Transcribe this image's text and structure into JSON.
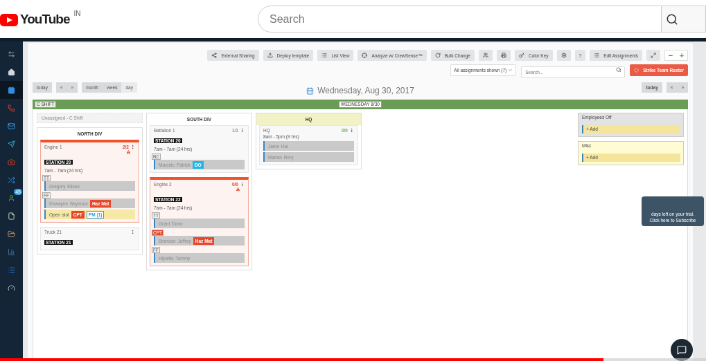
{
  "header": {
    "logo": "YouTube",
    "region": "IN",
    "search": {
      "placeholder": "Search"
    }
  },
  "sidebar": {
    "items": [
      {
        "kind": "swap",
        "selected": false
      },
      {
        "kind": "home",
        "selected": false
      },
      {
        "kind": "calendar",
        "selected": true
      },
      {
        "kind": "phone",
        "selected": false
      },
      {
        "kind": "mail",
        "selected": false
      },
      {
        "kind": "send",
        "selected": false
      },
      {
        "kind": "camera",
        "selected": false
      },
      {
        "kind": "shuffle",
        "selected": false
      },
      {
        "kind": "person",
        "selected": false,
        "badge": "45"
      },
      {
        "kind": "file",
        "selected": false
      },
      {
        "kind": "folder",
        "selected": false
      },
      {
        "kind": "signal",
        "selected": false
      },
      {
        "kind": "list",
        "selected": false
      },
      {
        "kind": "gauge",
        "selected": false
      }
    ]
  },
  "toolbar": [
    {
      "kind": "share",
      "label": "External Sharing"
    },
    {
      "kind": "upload",
      "label": "Deploy template"
    },
    {
      "kind": "list",
      "label": "List View"
    },
    {
      "kind": "target",
      "label": "Analyze w/ CrewSense™"
    },
    {
      "kind": "refresh",
      "label": "Bulk Change"
    },
    {
      "kind": "users"
    },
    {
      "kind": "print"
    },
    {
      "kind": "key",
      "label": "Color Key"
    },
    {
      "kind": "settings"
    },
    {
      "kind": "text",
      "label": "?"
    },
    {
      "kind": "list",
      "label": "Edit Assignments"
    },
    {
      "kind": "expand"
    }
  ],
  "zoom": {
    "minus": "−",
    "plus": "+"
  },
  "filter": "All assignments shown (7)",
  "search": {
    "placeholder": "Search..."
  },
  "strike_button": "Strike Team Roster",
  "nav_left": {
    "today": "today",
    "prev": "«",
    "next": "»",
    "views": [
      {
        "label": "month",
        "selected": false
      },
      {
        "label": "week",
        "selected": false
      },
      {
        "label": "day",
        "selected": true
      }
    ]
  },
  "date_title": "Wednesday, Aug 30, 2017",
  "nav_right": {
    "today": "today",
    "prev": "«",
    "next": "»"
  },
  "shift": {
    "name": "C SHIFT",
    "day": "WEDNESDAY 8/30"
  },
  "unassigned": "Unassigned - C Shift",
  "divisions": [
    {
      "name": "NORTH DIV",
      "color": "#ffffff",
      "units": [
        {
          "name": "Engine 1",
          "count": "2/2",
          "alert": true,
          "station": "STATION 20",
          "hours": "7am - 7am (24 hrs)",
          "members": [
            {
              "kind": "person",
              "name": "Gregory  Ellseo",
              "rank": {
                "label": "TT",
                "color": "#eeeeee"
              }
            },
            {
              "kind": "person",
              "name": "Dewayne  Seymour",
              "rank": {
                "label": "FF",
                "color": "#eeeeee"
              },
              "tags": [
                {
                  "label": "Haz Mat",
                  "color": "#e8472a",
                  "outline": false
                }
              ]
            },
            {
              "kind": "slot",
              "name": "Open slot",
              "tags": [
                {
                  "label": "CPT",
                  "color": "#e8472a",
                  "outline": false
                },
                {
                  "label": "PM (1)",
                  "color": "#3a9ad9",
                  "outline": true
                }
              ]
            }
          ]
        },
        {
          "name": "Truck 21",
          "alert": false,
          "station": "STATION 21"
        }
      ]
    },
    {
      "name": "SOUTH DIV",
      "color": "#ffffff",
      "units": [
        {
          "name": "Battalion 1",
          "count": "1/1",
          "alert": false,
          "station": "STATION 20",
          "hours": "7am - 7am (24 hrs)",
          "members": [
            {
              "kind": "person",
              "name": "Marcelo  Patrick",
              "rank": {
                "label": "BC",
                "color": "#eeeeee"
              },
              "tags": [
                {
                  "label": "DO",
                  "color": "#22b5e8",
                  "outline": false
                }
              ]
            }
          ]
        },
        {
          "name": "Engine 2",
          "count": "0/0",
          "alert": true,
          "station": "STATION 22",
          "hours": "7am - 7am (24 hrs)",
          "members": [
            {
              "kind": "person",
              "name": "Grant  Donn",
              "rank": {
                "label": "TT",
                "color": "#eeeeee"
              }
            },
            {
              "kind": "person",
              "name": "Brandon Jeffrey",
              "rank": {
                "label": "CPT",
                "color": "#e8472a"
              },
              "tags": [
                {
                  "label": "Haz Mat",
                  "color": "#e8472a",
                  "outline": false
                }
              ]
            },
            {
              "kind": "person",
              "name": "Hipolito  Tommy",
              "rank": {
                "label": "FF",
                "color": "#eeeeee"
              }
            }
          ]
        }
      ]
    },
    {
      "name": "HQ",
      "color": "#f3f2c6",
      "units": [
        {
          "name": "HQ",
          "count": "0/0",
          "alert": false,
          "hours": "8am - 5pm (9 hrs)",
          "members": [
            {
              "kind": "person",
              "name": "Jame  Hai"
            },
            {
              "kind": "person",
              "name": "Marlon  Rory"
            }
          ]
        }
      ]
    }
  ],
  "side_lists": [
    {
      "title": "Employees Off",
      "color": "#e3e3e3",
      "add": "+ Add"
    },
    {
      "title": "Misc",
      "color": "#fffbd2",
      "add": "+ Add"
    }
  ],
  "trial": {
    "line1": "days left on your trial.",
    "line2": "Click here to Subscribe"
  },
  "progress": {
    "level": 0.855
  }
}
